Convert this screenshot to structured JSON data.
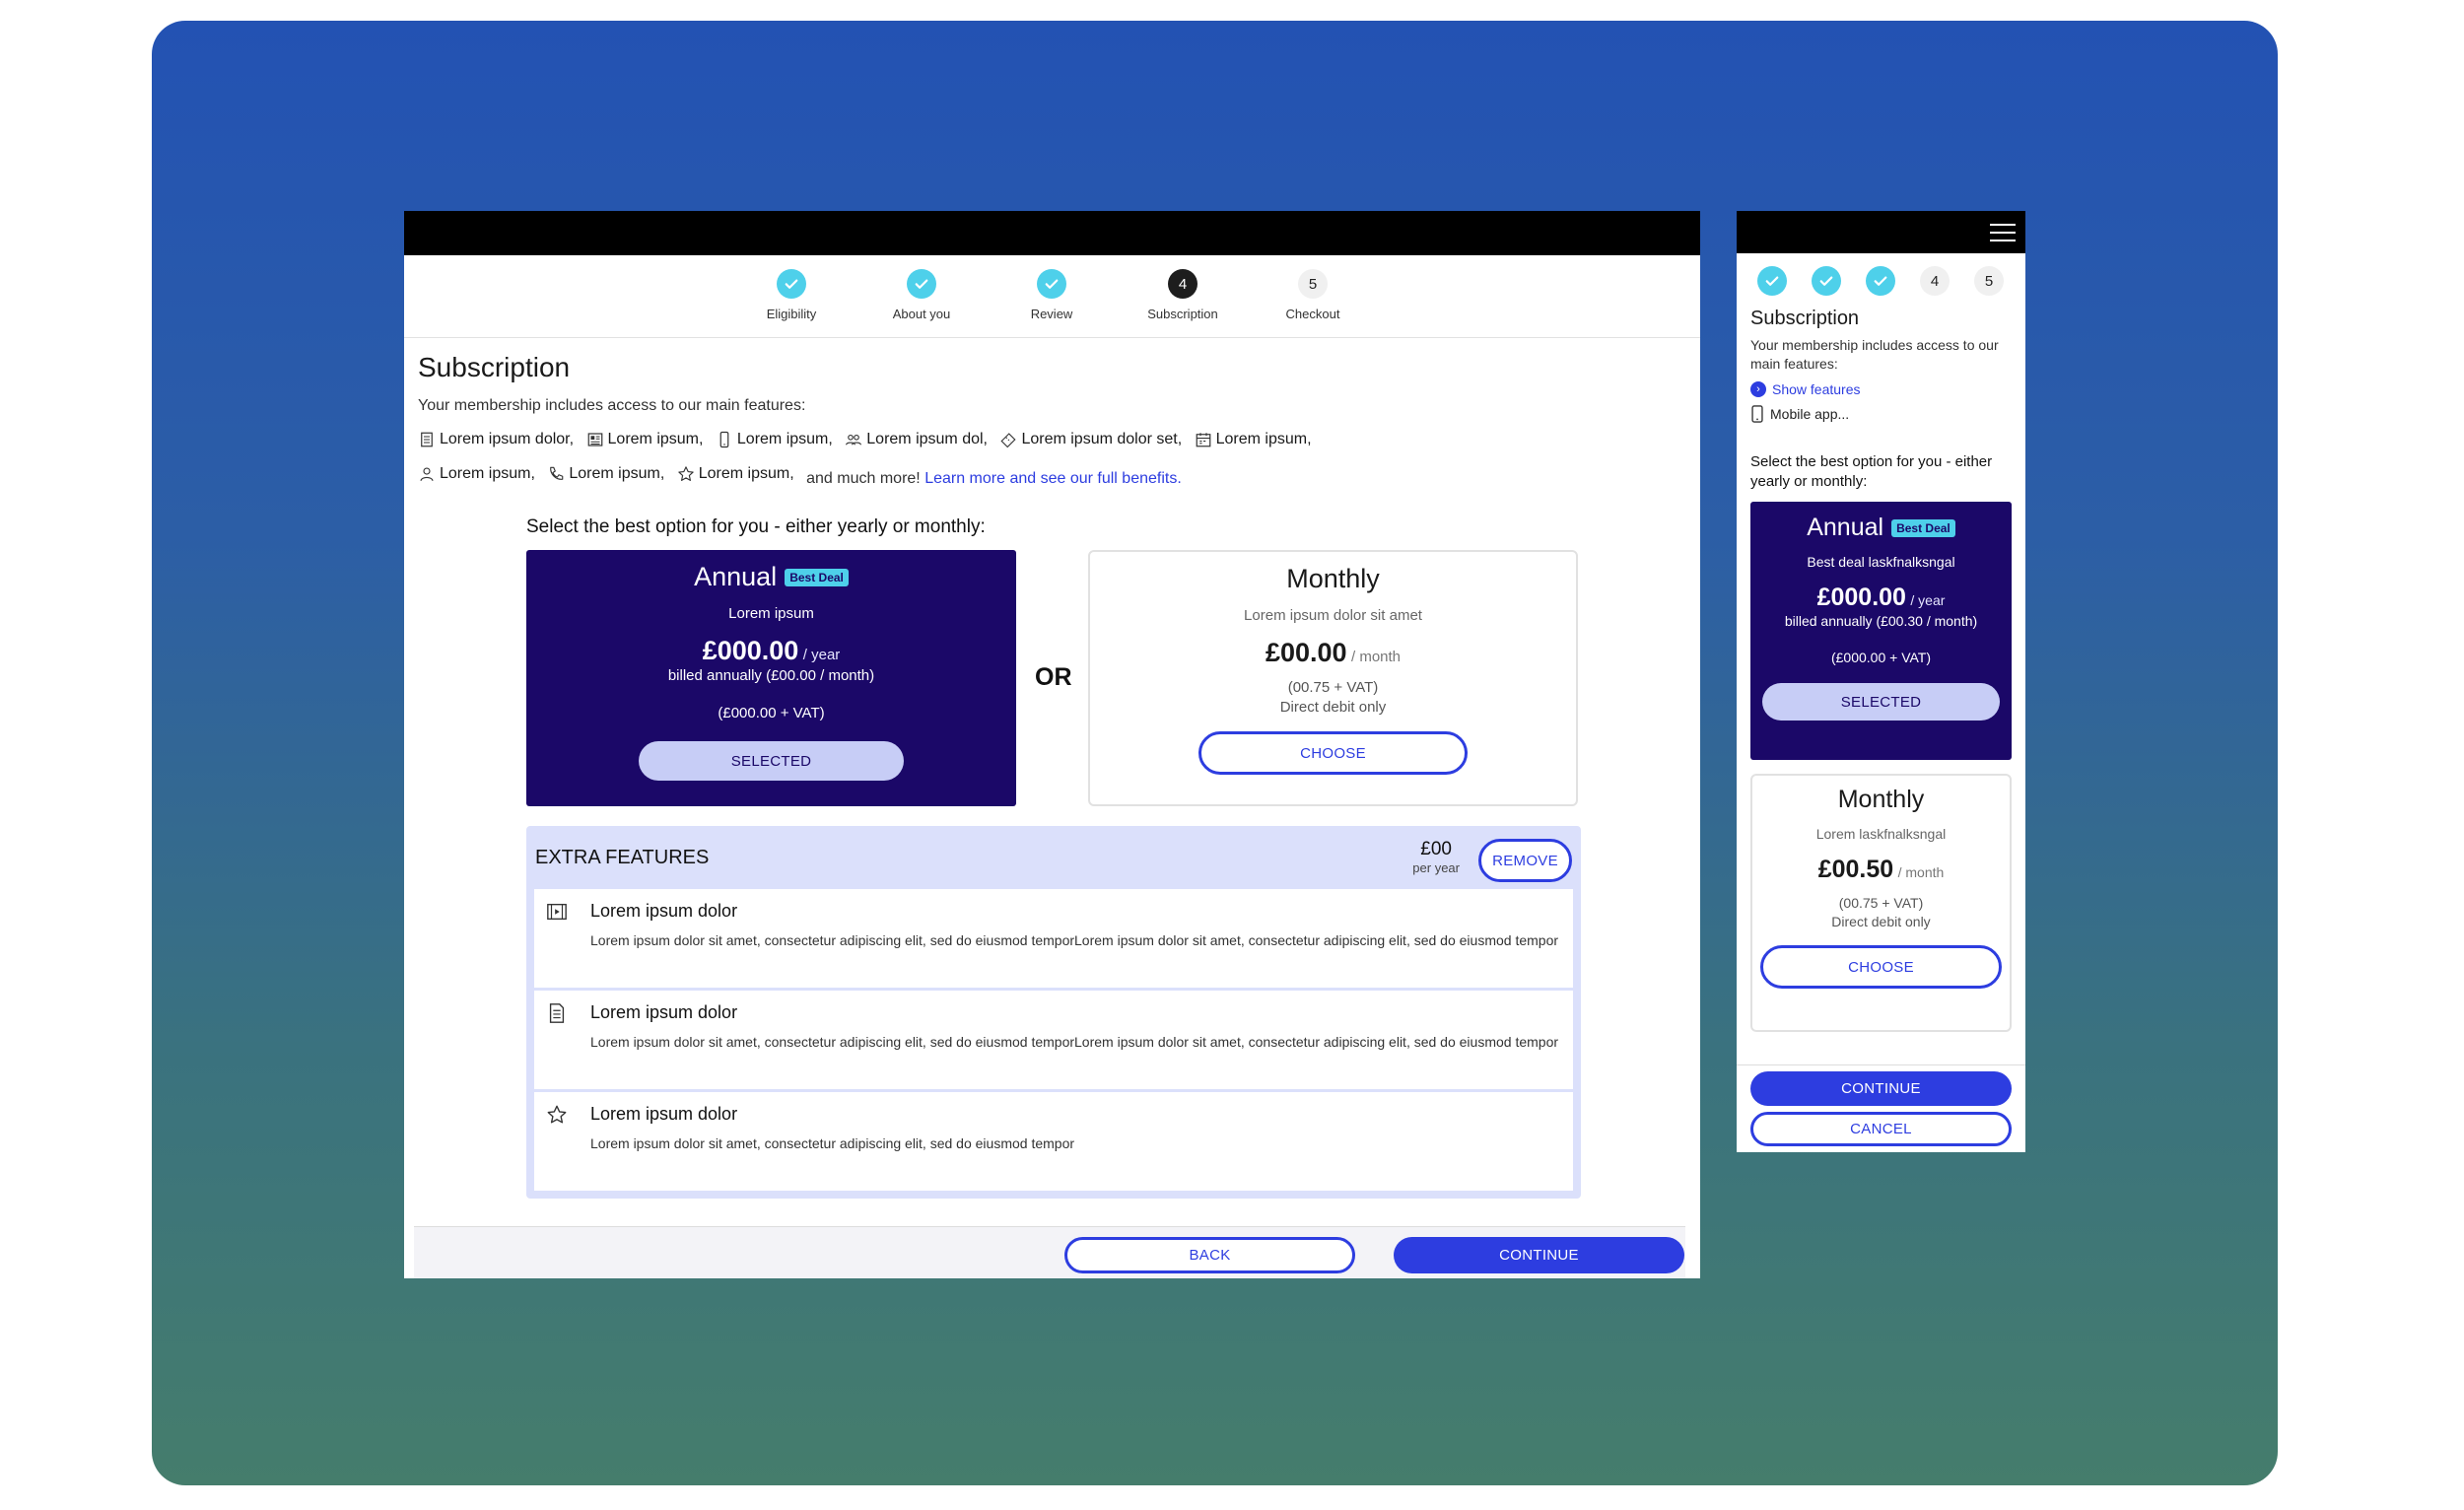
{
  "colors": {
    "accent": "#2d3de0",
    "plan_dark": "#1b0868",
    "step_done": "#4ed0ea",
    "extras_bg": "#dbe0fb"
  },
  "stepper": [
    {
      "label": "Eligibility",
      "state": "done",
      "number": ""
    },
    {
      "label": "About you",
      "state": "done",
      "number": ""
    },
    {
      "label": "Review",
      "state": "done",
      "number": ""
    },
    {
      "label": "Subscription",
      "state": "current",
      "number": "4"
    },
    {
      "label": "Checkout",
      "state": "todo",
      "number": "5"
    }
  ],
  "page": {
    "title": "Subscription",
    "intro": "Your membership includes access to our main features:",
    "features_row1": [
      {
        "icon": "document-icon",
        "text": "Lorem ipsum dolor,"
      },
      {
        "icon": "newspaper-icon",
        "text": "Lorem ipsum,"
      },
      {
        "icon": "phone-icon",
        "text": "Lorem ipsum,"
      },
      {
        "icon": "group-icon",
        "text": "Lorem ipsum dol,"
      },
      {
        "icon": "ticket-icon",
        "text": "Lorem ipsum dolor set,"
      },
      {
        "icon": "calendar-icon",
        "text": "Lorem ipsum,"
      }
    ],
    "features_row2": [
      {
        "icon": "person-icon",
        "text": "Lorem ipsum,"
      },
      {
        "icon": "call-icon",
        "text": "Lorem ipsum,"
      },
      {
        "icon": "star-icon",
        "text": "Lorem ipsum,"
      }
    ],
    "more_text": "and much more!",
    "more_link": "Learn more and see our full benefits.",
    "select_title": "Select the best option for you - either yearly or monthly:",
    "or_label": "OR"
  },
  "annual": {
    "name": "Annual",
    "badge": "Best Deal",
    "subtitle": "Lorem ipsum",
    "price": "£000.00",
    "period": "/ year",
    "billing": "billed annually (£00.00 / month)",
    "vat": "(£000.00 + VAT)",
    "button": "SELECTED"
  },
  "monthly": {
    "name": "Monthly",
    "subtitle": "Lorem ipsum dolor sit amet",
    "price": "£00.00",
    "period": "/ month",
    "vat": "(00.75 + VAT)",
    "debit": "Direct debit only",
    "button": "CHOOSE"
  },
  "extras": {
    "title": "EXTRA FEATURES",
    "price": "£00",
    "per": "per year",
    "remove": "REMOVE",
    "items": [
      {
        "icon": "video-icon",
        "title": "Lorem ipsum dolor",
        "desc": "Lorem ipsum dolor sit amet, consectetur adipiscing elit, sed do eiusmod temporLorem ipsum dolor sit amet, consectetur adipiscing elit, sed do eiusmod tempor"
      },
      {
        "icon": "document-icon",
        "title": "Lorem ipsum dolor",
        "desc": "Lorem ipsum dolor sit amet, consectetur adipiscing elit, sed do eiusmod temporLorem ipsum dolor sit amet, consectetur adipiscing elit, sed do eiusmod tempor"
      },
      {
        "icon": "star-icon",
        "title": "Lorem ipsum dolor",
        "desc": "Lorem ipsum dolor sit amet, consectetur adipiscing elit, sed do eiusmod tempor"
      }
    ]
  },
  "footer": {
    "back": "BACK",
    "continue": "CONTINUE"
  },
  "mobile": {
    "steps": [
      "",
      "",
      "",
      "4",
      "5"
    ],
    "title": "Subscription",
    "intro": "Your membership includes access to our main features:",
    "show_features": "Show features",
    "mobile_app": "Mobile app...",
    "select_title": "Select the best option for you - either yearly or monthly:",
    "annual": {
      "name": "Annual",
      "badge": "Best Deal",
      "subtitle": "Best deal laskfnalksngal",
      "price": "£000.00",
      "period": "/ year",
      "billing": "billed annually (£00.30 / month)",
      "vat": "(£000.00 + VAT)",
      "button": "SELECTED"
    },
    "monthly": {
      "name": "Monthly",
      "subtitle": "Lorem laskfnalksngal",
      "price": "£00.50",
      "period": "/ month",
      "vat": "(00.75 + VAT)",
      "debit": "Direct debit only",
      "button": "CHOOSE"
    },
    "continue": "CONTINUE",
    "cancel": "CANCEL"
  }
}
